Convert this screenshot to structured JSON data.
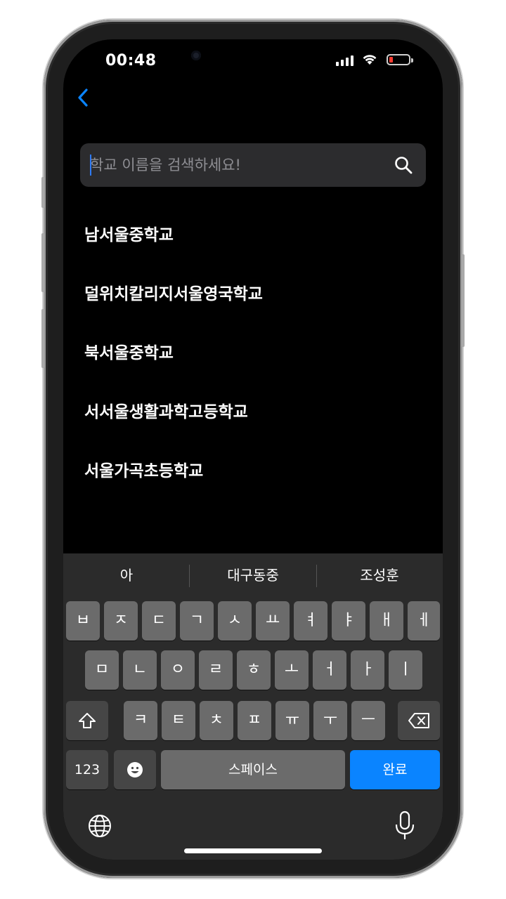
{
  "status_bar": {
    "time": "00:48"
  },
  "search": {
    "placeholder": "학교 이름을 검색하세요!",
    "value": ""
  },
  "results": [
    "남서울중학교",
    "덜위치칼리지서울영국학교",
    "북서울중학교",
    "서서울생활과학고등학교",
    "서울가곡초등학교"
  ],
  "keyboard": {
    "suggestions": [
      "아",
      "대구동중",
      "조성훈"
    ],
    "row1": [
      "ㅂ",
      "ㅈ",
      "ㄷ",
      "ㄱ",
      "ㅅ",
      "ㅛ",
      "ㅕ",
      "ㅑ",
      "ㅐ",
      "ㅔ"
    ],
    "row2": [
      "ㅁ",
      "ㄴ",
      "ㅇ",
      "ㄹ",
      "ㅎ",
      "ㅗ",
      "ㅓ",
      "ㅏ",
      "ㅣ"
    ],
    "row3": [
      "ㅋ",
      "ㅌ",
      "ㅊ",
      "ㅍ",
      "ㅠ",
      "ㅜ",
      "ㅡ"
    ],
    "numbers_label": "123",
    "space_label": "스페이스",
    "done_label": "완료"
  },
  "icons": {
    "back": "chevron-left-icon",
    "search": "search-icon",
    "shift": "shift-icon",
    "delete": "backspace-icon",
    "emoji": "emoji-icon",
    "globe": "globe-icon",
    "mic": "microphone-icon"
  },
  "colors": {
    "accent": "#0a84ff",
    "battery_low": "#ff3b30"
  }
}
